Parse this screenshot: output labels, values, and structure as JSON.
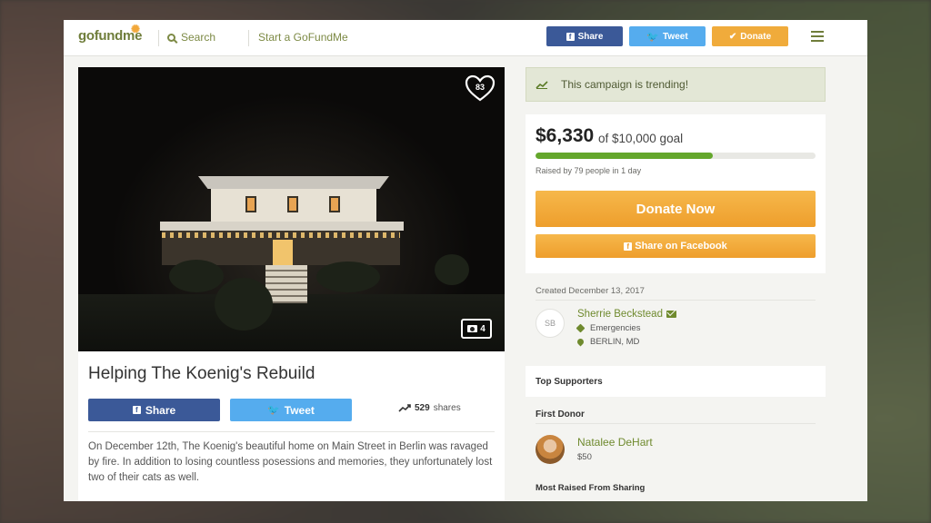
{
  "header": {
    "logo_go": "go",
    "logo_fund": "fund",
    "logo_me": "me",
    "search_label": "Search",
    "start_label": "Start a GoFundMe",
    "share_label": "Share",
    "tweet_label": "Tweet",
    "donate_label": "Donate"
  },
  "photo": {
    "likes": "83",
    "photo_count": "4"
  },
  "campaign": {
    "title": "Helping The Koenig's Rebuild",
    "share_label": "Share",
    "tweet_label": "Tweet",
    "shares_count": "529",
    "shares_label": "shares",
    "description": "On December 12th, The Koenig's beautiful home on Main Street in Berlin was ravaged by fire. In addition to losing countless posessions and memories, they unfortunately lost two of their cats as well."
  },
  "trending": {
    "text": "This campaign is trending!"
  },
  "donation": {
    "raised": "$6,330",
    "goal_text": "of $10,000 goal",
    "progress_fraction": 0.633,
    "raised_by": "Raised by 79 people in 1 day",
    "donate_now_label": "Donate Now",
    "share_fb_label": "Share on Facebook"
  },
  "organizer": {
    "created": "Created December 13, 2017",
    "initials": "SB",
    "name": "Sherrie Beckstead",
    "category": "Emergencies",
    "location": "BERLIN, MD"
  },
  "supporters": {
    "top_label": "Top Supporters",
    "first_donor_label": "First Donor",
    "donor_name": "Natalee DeHart",
    "donor_amount": "$50",
    "most_raised_label": "Most Raised From Sharing"
  },
  "colors": {
    "facebook": "#3b5998",
    "twitter": "#55acee",
    "donate_orange": "#f0ab3b",
    "brand_green": "#6f7d3a",
    "progress_green": "#64a72c"
  }
}
